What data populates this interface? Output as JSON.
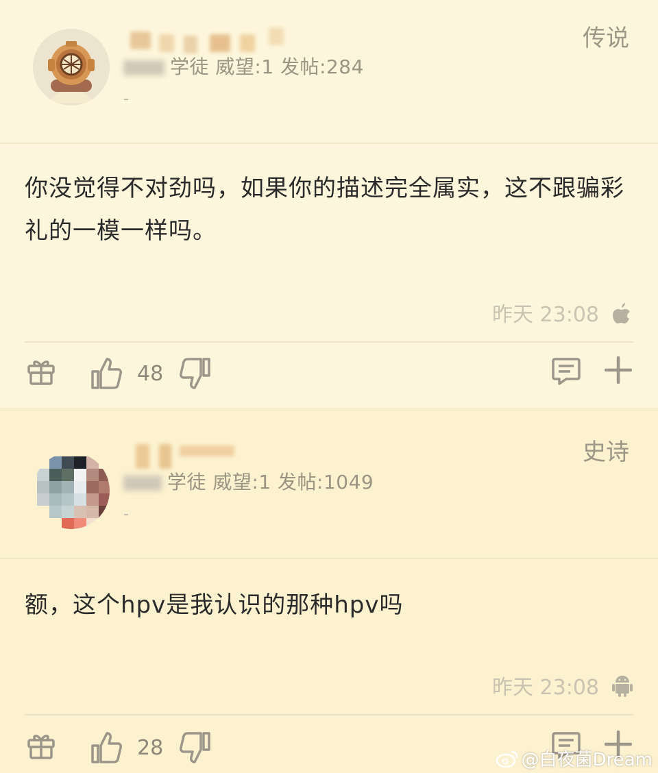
{
  "posts": [
    {
      "rank": "传说",
      "meta": "学徒 威望:1 发帖:284",
      "dash": "-",
      "content": "你没觉得不对劲吗，如果你的描述完全属实，这不跟骗彩礼的一模一样吗。",
      "time": "昨天 23:08",
      "os": "apple-icon",
      "likes": "48"
    },
    {
      "rank": "史诗",
      "meta": "学徒 威望:1 发帖:1049",
      "dash": "-",
      "content": "额，这个hpv是我认识的那种hpv吗",
      "time": "昨天 23:08",
      "os": "android-icon",
      "likes": "28"
    }
  ],
  "watermark": "@白夜菌Dream",
  "colors": {
    "background": "#fdf6dc",
    "text": "#2a2a2a",
    "muted": "#9a9483"
  }
}
